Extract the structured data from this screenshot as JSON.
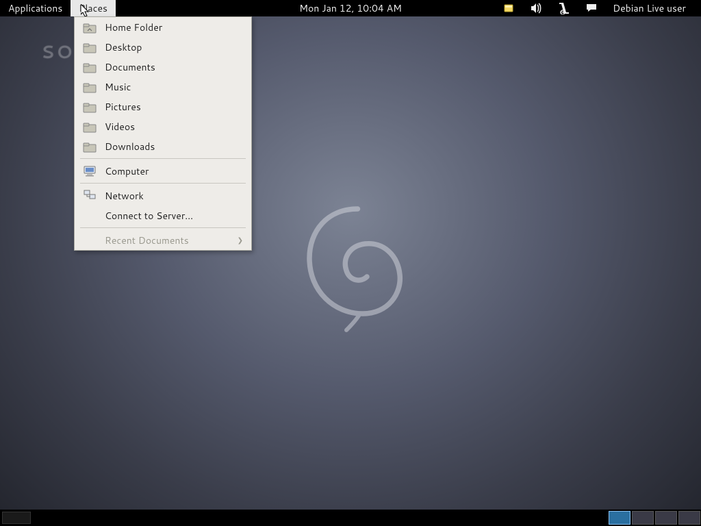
{
  "top_panel": {
    "applications": "Applications",
    "places": "Places",
    "clock": "Mon Jan 12, 10:04 AM",
    "user": "Debian Live user"
  },
  "watermark": "SOFTPEDIA",
  "places_menu": {
    "items": [
      {
        "icon": "home-folder-icon",
        "label": "Home Folder"
      },
      {
        "icon": "folder-icon",
        "label": "Desktop"
      },
      {
        "icon": "folder-icon",
        "label": "Documents"
      },
      {
        "icon": "folder-icon",
        "label": "Music"
      },
      {
        "icon": "folder-icon",
        "label": "Pictures"
      },
      {
        "icon": "folder-icon",
        "label": "Videos"
      },
      {
        "icon": "folder-icon",
        "label": "Downloads"
      }
    ],
    "computer": "Computer",
    "network": "Network",
    "connect": "Connect to Server...",
    "recent": "Recent Documents"
  },
  "workspaces": 4,
  "current_workspace": 1
}
